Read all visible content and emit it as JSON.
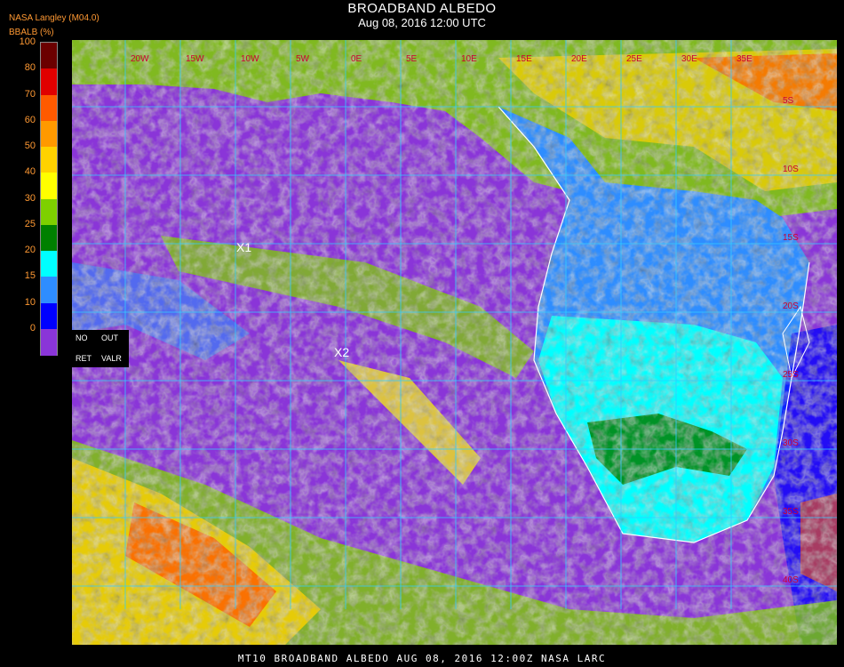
{
  "header": {
    "title": "BROADBAND ALBEDO",
    "subtitle": "Aug 08, 2016 12:00 UTC",
    "source": "NASA Langley (M04.0)"
  },
  "colorbar": {
    "label": "BBALB (%)",
    "ticks": [
      "100",
      "80",
      "70",
      "60",
      "50",
      "40",
      "30",
      "25",
      "20",
      "15",
      "10",
      "0"
    ],
    "colors": [
      "#6b0000",
      "#e00000",
      "#ff5a00",
      "#ff9900",
      "#ffd200",
      "#ffff00",
      "#7ed000",
      "#008000",
      "#00ffff",
      "#2e8dff",
      "#0000ff",
      "#8a35d8"
    ]
  },
  "legend_box": {
    "no": "NO",
    "out": "OUT",
    "ret": "RET",
    "valr": "VALR"
  },
  "markers": [
    {
      "label": "X1"
    },
    {
      "label": "X2"
    }
  ],
  "map": {
    "lon_labels": [
      "20W",
      "15W",
      "10W",
      "5W",
      "0E",
      "5E",
      "10E",
      "15E",
      "20E",
      "25E",
      "30E",
      "35E"
    ],
    "lat_labels": [
      "5S",
      "10S",
      "15S",
      "20S",
      "25S",
      "30S",
      "35S",
      "40S"
    ],
    "label_color": "#cc0033",
    "grid_color": "#33ccff"
  },
  "footer": "MT10  BROADBAND ALBEDO   AUG 08, 2016 12:00Z   NASA LARC"
}
